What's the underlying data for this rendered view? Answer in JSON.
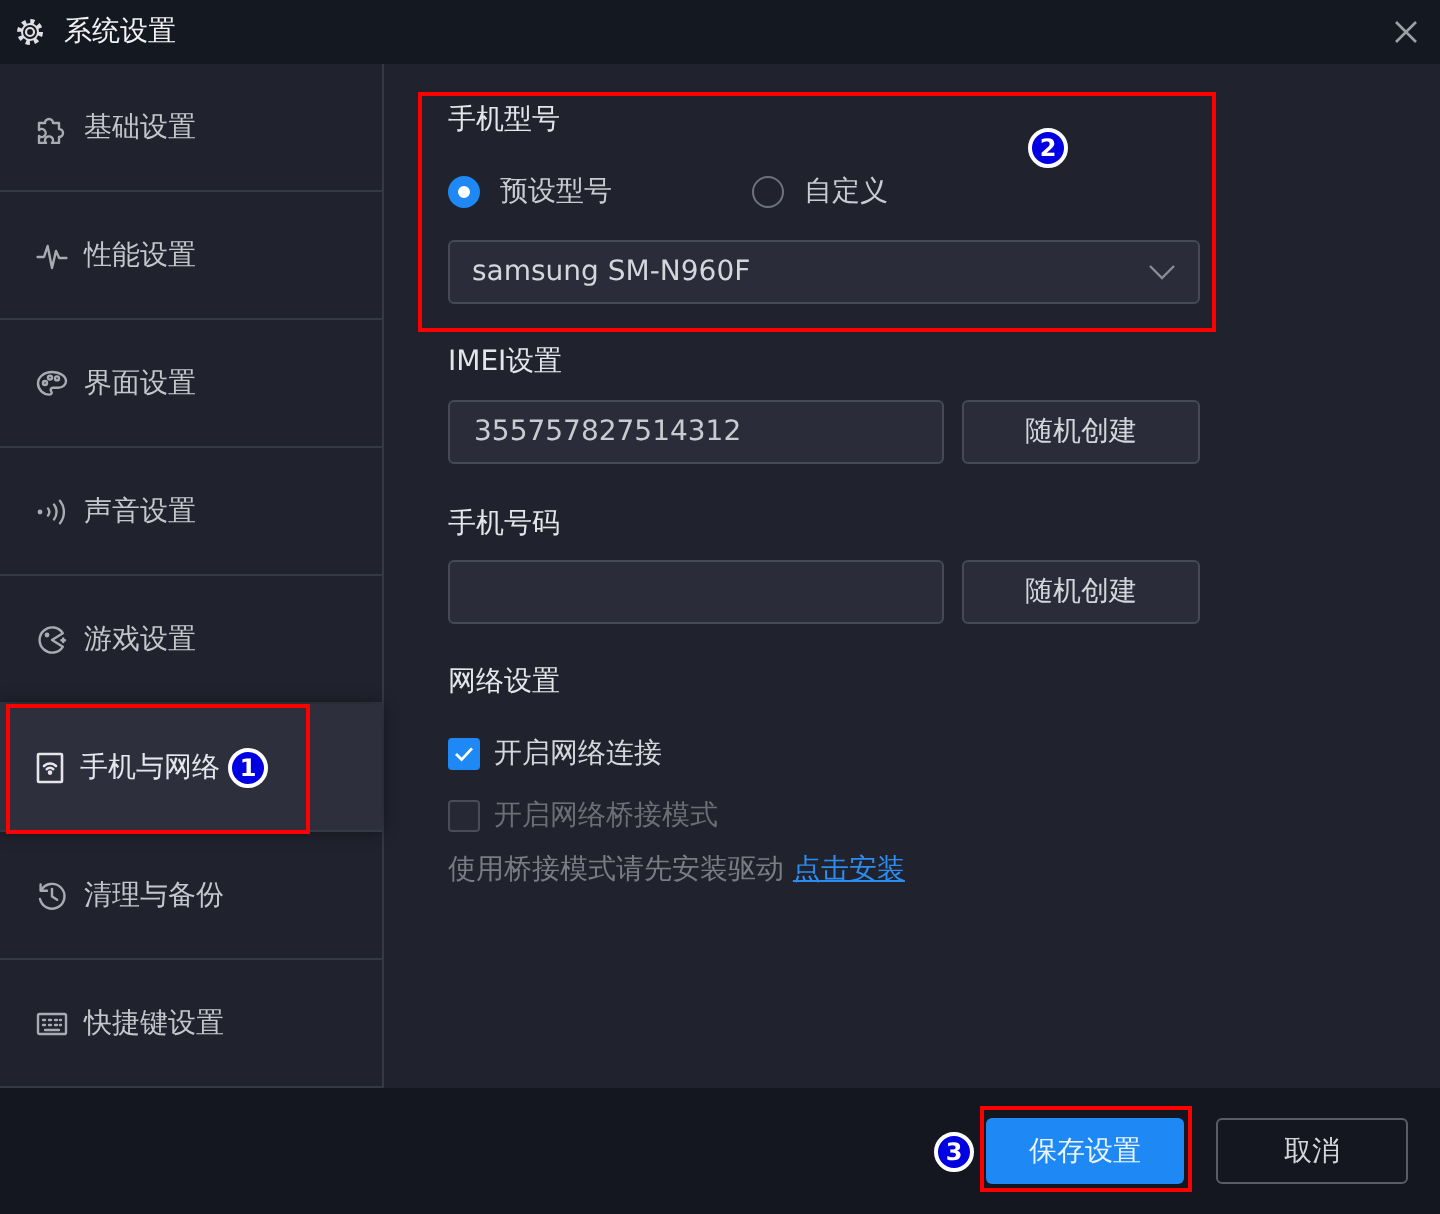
{
  "window": {
    "title": "系统设置"
  },
  "sidebar": {
    "items": [
      {
        "label": "基础设置",
        "selected": false
      },
      {
        "label": "性能设置",
        "selected": false
      },
      {
        "label": "界面设置",
        "selected": false
      },
      {
        "label": "声音设置",
        "selected": false
      },
      {
        "label": "游戏设置",
        "selected": false
      },
      {
        "label": "手机与网络",
        "selected": true,
        "annotation": "1"
      },
      {
        "label": "清理与备份",
        "selected": false
      },
      {
        "label": "快捷键设置",
        "selected": false
      }
    ]
  },
  "model": {
    "title": "手机型号",
    "annotation": "2",
    "options": [
      {
        "label": "预设型号",
        "selected": true
      },
      {
        "label": "自定义",
        "selected": false
      }
    ],
    "dropdown": {
      "value": "samsung SM-N960F"
    }
  },
  "fields": [
    {
      "title": "IMEI设置",
      "value": "355757827514312",
      "button": "随机创建"
    },
    {
      "title": "手机号码",
      "button": "随机创建"
    }
  ],
  "network": {
    "title": "网络设置",
    "options": [
      {
        "label": "开启网络连接",
        "checked": true,
        "disabled": false
      },
      {
        "label": "开启网络桥接模式",
        "checked": false,
        "disabled": true
      }
    ],
    "hint": "使用桥接模式请先安装驱动",
    "link": "点击安装"
  },
  "footer": {
    "buttons": [
      {
        "label": "保存设置",
        "kind": "primary",
        "annotation": "3"
      },
      {
        "label": "取消",
        "kind": "secondary"
      }
    ]
  }
}
